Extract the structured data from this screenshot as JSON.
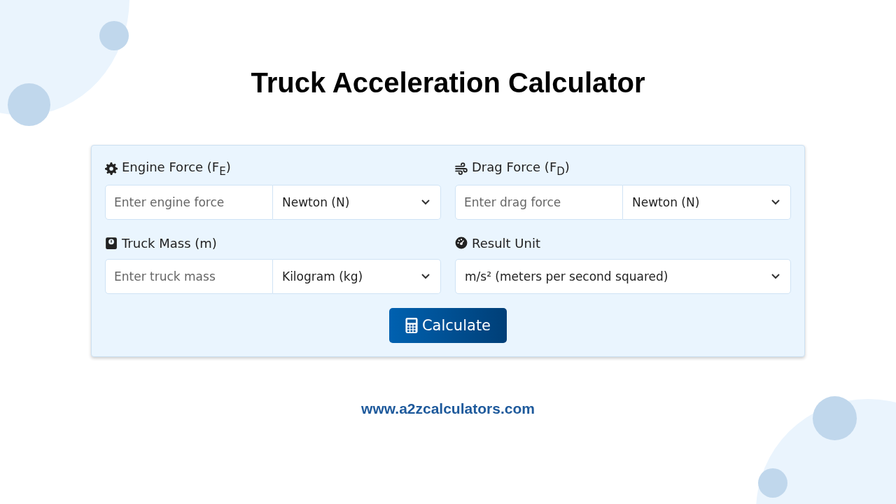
{
  "title": "Truck Acceleration Calculator",
  "fields": [
    {
      "kind": "input_unit",
      "label": "Engine Force (F$_{E}$)",
      "placeholder": "Enter engine force",
      "unit": "Newton (N)"
    },
    {
      "kind": "input_unit",
      "label": "Drag Force (F$_{D}$)",
      "placeholder": "Enter drag force",
      "unit": "Newton (N)"
    },
    {
      "kind": "input_unit",
      "label": "Truck Mass (m)",
      "placeholder": "Enter truck mass",
      "unit": "Kilogram (kg)"
    },
    {
      "kind": "select",
      "label": "Result Unit",
      "unit": "m/s² (meters per second squared)"
    }
  ],
  "button": "Calculate",
  "footer": "www.a2zcalculators.com"
}
